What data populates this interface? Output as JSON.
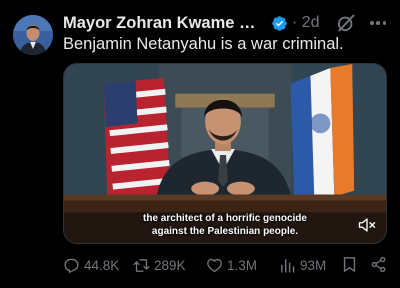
{
  "tweet": {
    "author_name": "Mayor Zohran Kwame Ma...",
    "timestamp": "· 2d",
    "text": "Benjamin Netanyahu is a war criminal.",
    "verified_color": "#1d9bf0"
  },
  "media": {
    "caption_line1": "the architect of a horrific genocide",
    "caption_line2": "against the Palestinian people."
  },
  "actions": {
    "reply_count": "44.8K",
    "repost_count": "289K",
    "like_count": "1.3M",
    "view_count": "93M"
  },
  "icons": [
    "avatar",
    "verified-icon",
    "grok-icon",
    "more-icon",
    "mute-icon",
    "reply-icon",
    "repost-icon",
    "like-icon",
    "views-icon",
    "bookmark-icon",
    "share-icon"
  ]
}
